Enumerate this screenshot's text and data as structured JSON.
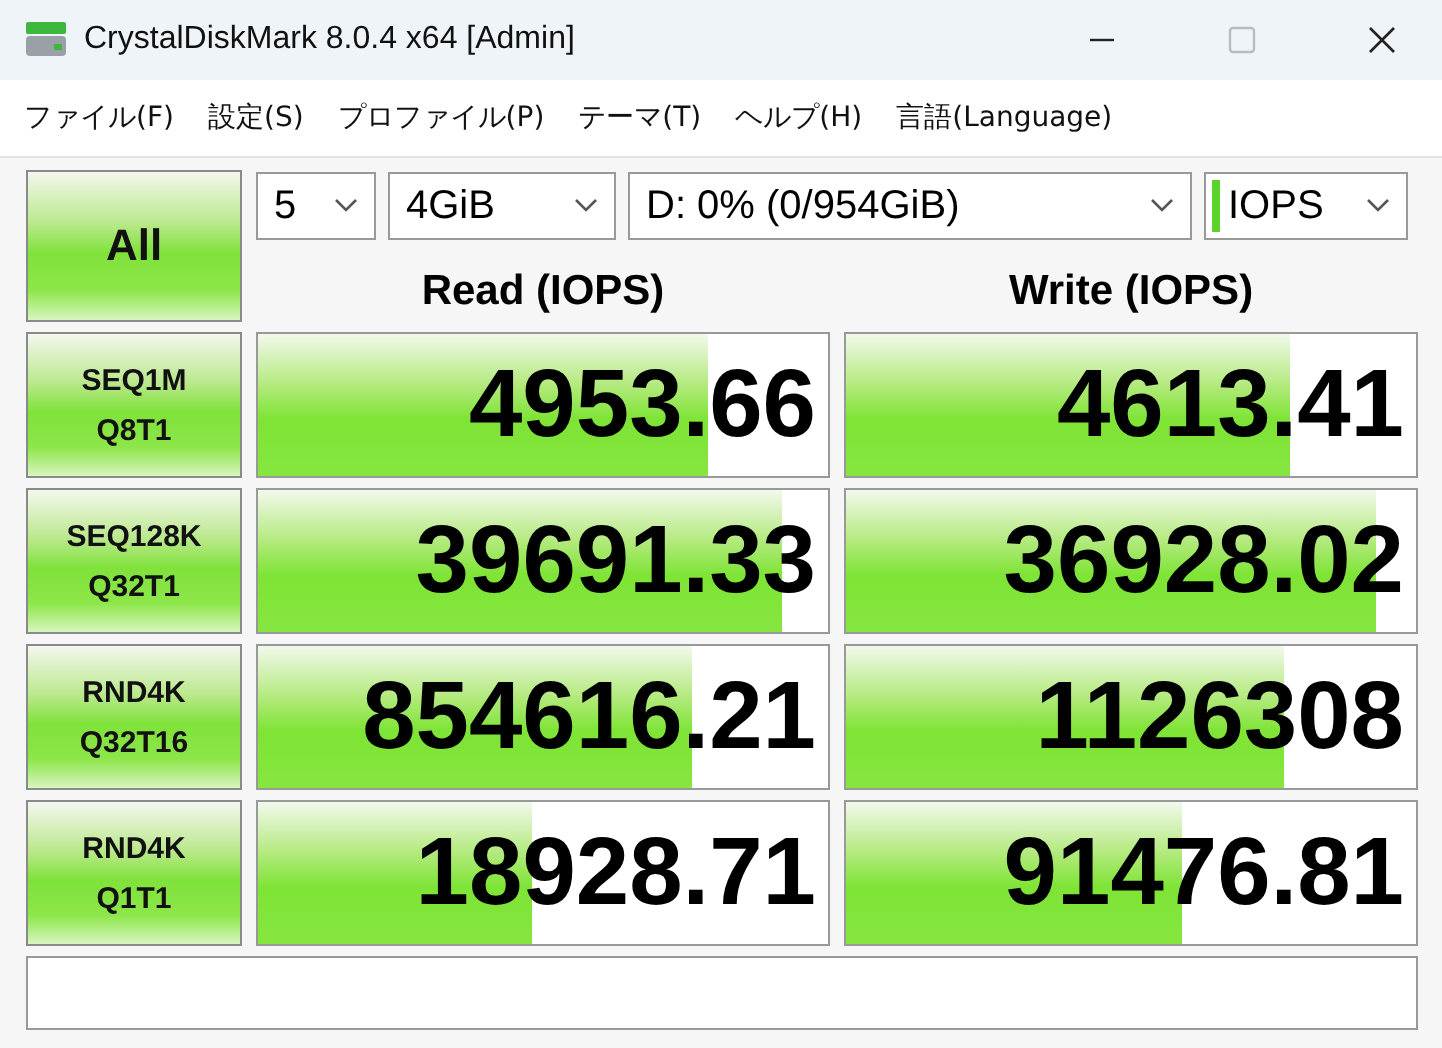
{
  "window": {
    "title": "CrystalDiskMark 8.0.4 x64 [Admin]"
  },
  "menu": [
    "ファイル(F)",
    "設定(S)",
    "プロファイル(P)",
    "テーマ(T)",
    "ヘルプ(H)",
    "言語(Language)"
  ],
  "all_button": "All",
  "selectors": [
    {
      "value": "5",
      "indicator": false
    },
    {
      "value": "4GiB",
      "indicator": false
    },
    {
      "value": "D: 0% (0/954GiB)",
      "indicator": false
    },
    {
      "value": "IOPS",
      "indicator": true
    }
  ],
  "columns": [
    "Read (IOPS)",
    "Write (IOPS)"
  ],
  "tests": [
    {
      "name": "SEQ1M",
      "params": "Q8T1",
      "read": {
        "value": "4953.66",
        "level": 0.79
      },
      "write": {
        "value": "4613.41",
        "level": 0.78
      }
    },
    {
      "name": "SEQ128K",
      "params": "Q32T1",
      "read": {
        "value": "39691.33",
        "level": 0.92
      },
      "write": {
        "value": "36928.02",
        "level": 0.93
      }
    },
    {
      "name": "RND4K",
      "params": "Q32T16",
      "read": {
        "value": "854616.21",
        "level": 0.76
      },
      "write": {
        "value": "1126308",
        "level": 0.77
      }
    },
    {
      "name": "RND4K",
      "params": "Q1T1",
      "read": {
        "value": "18928.71",
        "level": 0.48
      },
      "write": {
        "value": "91476.81",
        "level": 0.59
      }
    }
  ]
}
